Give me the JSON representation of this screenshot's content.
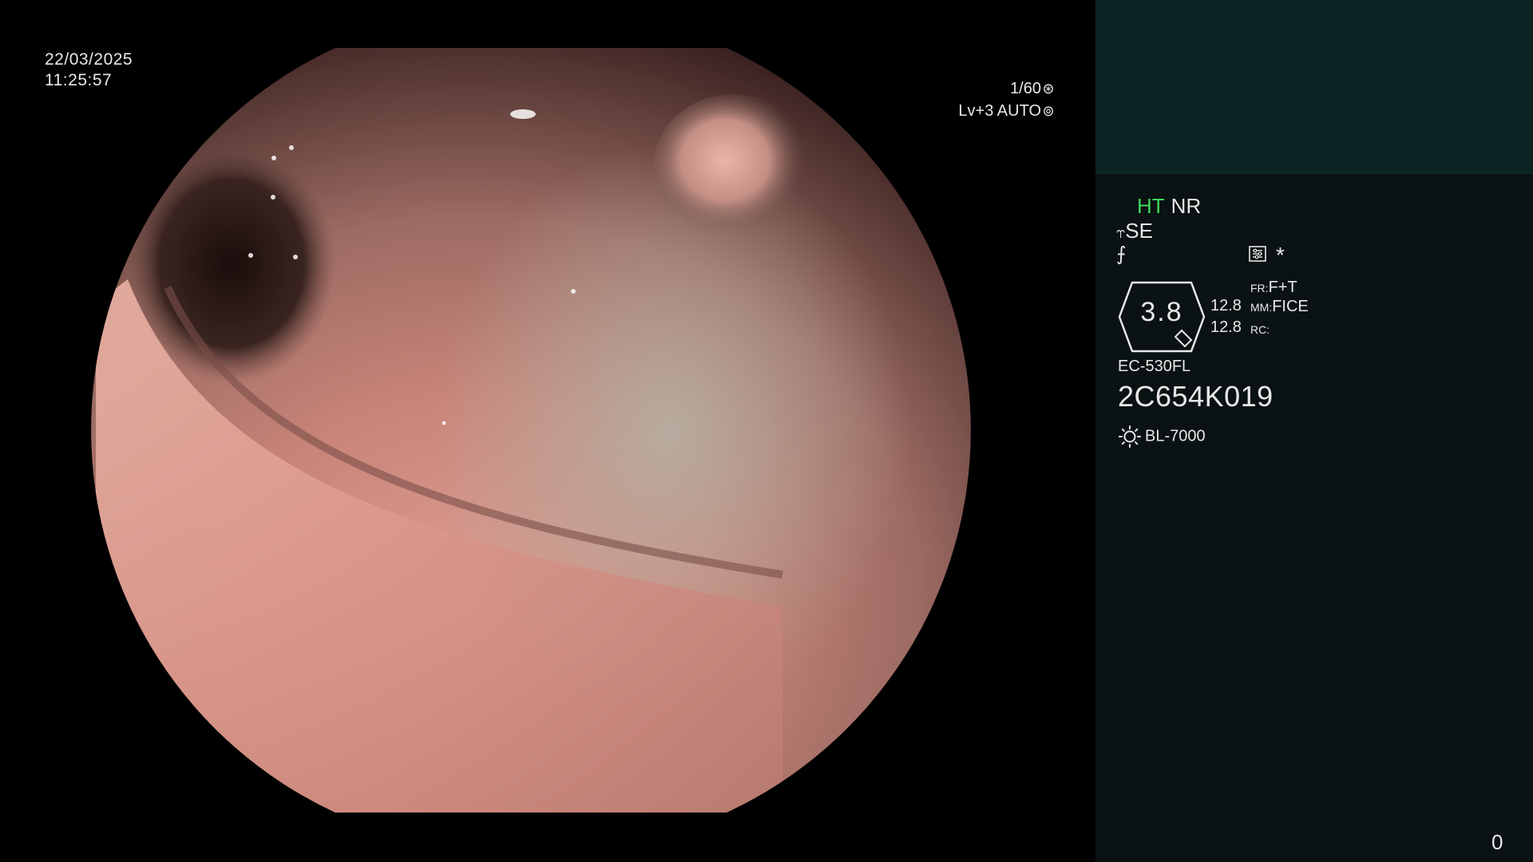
{
  "osd": {
    "date": "22/03/2025",
    "time": "11:25:57",
    "shutter": "1/60",
    "exposure": "Lv+3 AUTO"
  },
  "panel": {
    "ht": "HT",
    "nr": "NR",
    "se": "SE",
    "zoom": "3.8",
    "val_top": "12.8",
    "val_bottom": "12.8",
    "fr_label": "FR:",
    "fr_value": "F+T",
    "mm_label": "MM:",
    "mm_value": "FICE",
    "rc_label": "RC:",
    "rc_value": "",
    "scope_model": "EC-530FL",
    "serial": "2C654K019",
    "light_source": "BL-7000",
    "asterisk": "*",
    "counter": "0"
  },
  "colors": {
    "ht_green": "#3fd85a",
    "panel_bg": "#0a1213",
    "panel_top_bg": "#0c2323"
  },
  "icons": {
    "shutter": "aperture-icon",
    "auto": "iris-icon",
    "se": "se-mode-icon",
    "flag": "freeze-icon",
    "settings": "settings-icon",
    "light": "light-source-icon"
  }
}
